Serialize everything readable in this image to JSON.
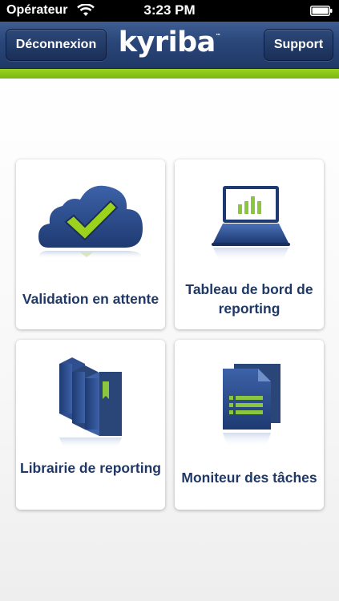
{
  "status_bar": {
    "carrier": "Opérateur",
    "time": "3:23 PM"
  },
  "nav": {
    "left_button": "Déconnexion",
    "brand": "kyriba",
    "brand_mark": "™",
    "right_button": "Support"
  },
  "colors": {
    "nav_blue": "#2a4679",
    "accent_green": "#8cc63f",
    "label_navy": "#1f3866"
  },
  "tiles": [
    {
      "label": "Validation en attente",
      "icon": "cloud-check-icon"
    },
    {
      "label": "Tableau de bord de reporting",
      "icon": "laptop-chart-icon"
    },
    {
      "label": "Librairie de reporting",
      "icon": "books-icon"
    },
    {
      "label": "Moniteur des tâches",
      "icon": "documents-icon"
    }
  ]
}
